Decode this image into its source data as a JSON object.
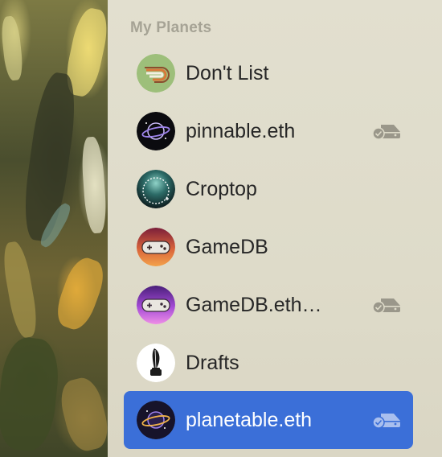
{
  "sidebar": {
    "section_title": "My Planets",
    "items": [
      {
        "label": "Don't List",
        "icon": "planet-avatar-dont-list",
        "synced": false,
        "selected": false
      },
      {
        "label": "pinnable.eth",
        "icon": "planet-avatar-pinnable",
        "synced": true,
        "selected": false
      },
      {
        "label": "Croptop",
        "icon": "planet-avatar-croptop",
        "synced": false,
        "selected": false
      },
      {
        "label": "GameDB",
        "icon": "planet-avatar-gamedb",
        "synced": false,
        "selected": false
      },
      {
        "label": "GameDB.eth…",
        "icon": "planet-avatar-gamedb-eth",
        "synced": true,
        "selected": false
      },
      {
        "label": "Drafts",
        "icon": "planet-avatar-drafts",
        "synced": false,
        "selected": false
      },
      {
        "label": "planetable.eth",
        "icon": "planet-avatar-planetable",
        "synced": true,
        "selected": true
      }
    ]
  },
  "colors": {
    "sidebar_bg": "#dedbc9",
    "section_title": "#a6a395",
    "selection": "#3b6fd8",
    "label": "#262626",
    "sync_icon": "#9a978a"
  }
}
